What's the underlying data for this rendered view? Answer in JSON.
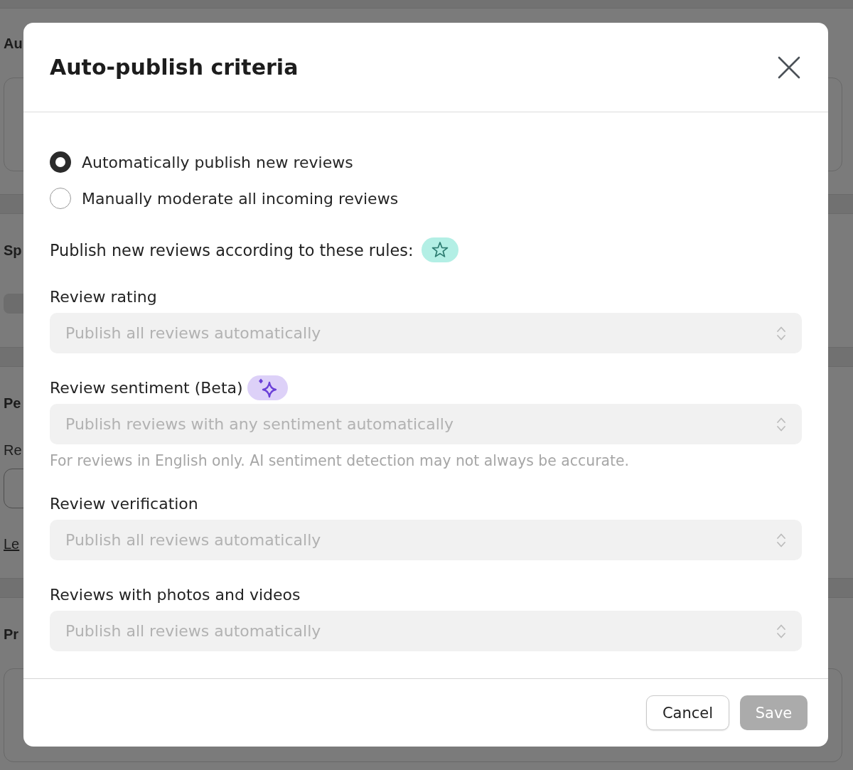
{
  "background_page": {
    "items": [
      {
        "kind": "heading",
        "text": "Au"
      },
      {
        "kind": "card"
      },
      {
        "kind": "band"
      },
      {
        "kind": "heading",
        "text": "Sp"
      },
      {
        "kind": "pill"
      },
      {
        "kind": "band"
      },
      {
        "kind": "heading",
        "text": "Pe"
      },
      {
        "kind": "label",
        "text": "Re"
      },
      {
        "kind": "input"
      },
      {
        "kind": "link",
        "text": "Le"
      },
      {
        "kind": "band"
      },
      {
        "kind": "heading",
        "text": "Pr"
      },
      {
        "kind": "card"
      }
    ]
  },
  "dialog": {
    "title": "Auto-publish criteria",
    "publish_mode": {
      "options": [
        {
          "label": "Automatically publish new reviews",
          "selected": true
        },
        {
          "label": "Manually moderate all incoming reviews",
          "selected": false
        }
      ]
    },
    "rules_heading": "Publish new reviews according to these rules:",
    "rules": [
      {
        "kind": "standard",
        "label": "Review rating",
        "value": "Publish all reviews automatically",
        "disabled": true
      },
      {
        "kind": "ai",
        "label": "Review sentiment (Beta)",
        "value": "Publish reviews with any sentiment automatically",
        "disabled": true,
        "hint": "For reviews in English only. AI sentiment detection may not always be accurate."
      },
      {
        "kind": "standard",
        "label": "Review verification",
        "value": "Publish all reviews automatically",
        "disabled": true
      },
      {
        "kind": "standard",
        "label": "Reviews with photos and videos",
        "value": "Publish all reviews automatically",
        "disabled": true
      }
    ],
    "buttons": [
      {
        "kind": "secondary",
        "label": "Cancel",
        "disabled": false
      },
      {
        "kind": "primary",
        "label": "Save",
        "disabled": true
      }
    ]
  }
}
